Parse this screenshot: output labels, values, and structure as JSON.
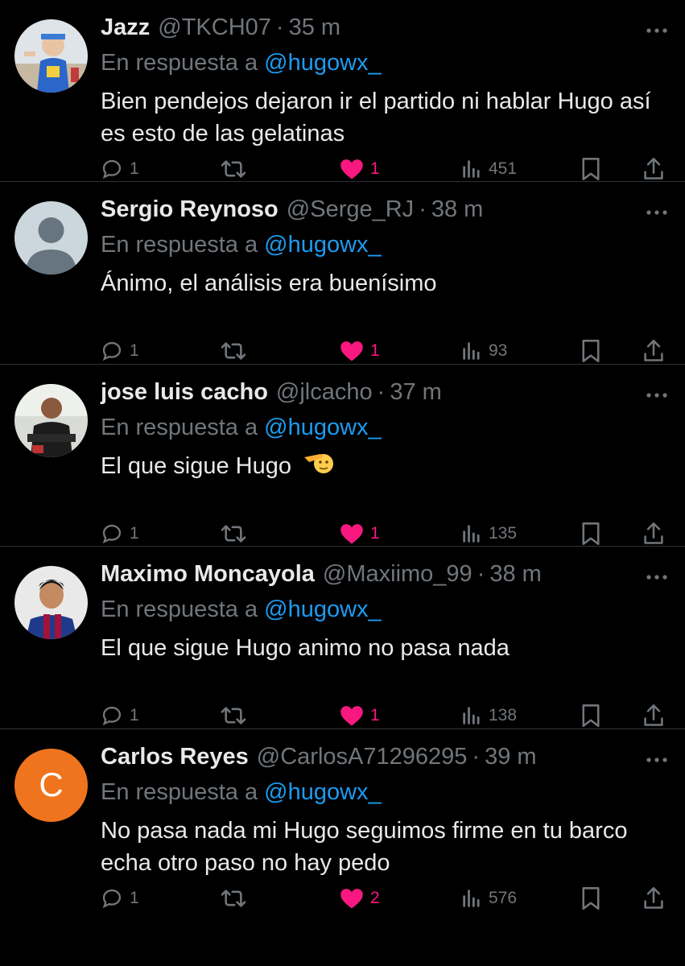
{
  "colors": {
    "background": "#000000",
    "text": "#e7e9ea",
    "muted": "#71767b",
    "mention": "#1d9bf0",
    "like": "#f91880",
    "divider": "#2f3336"
  },
  "replies": [
    {
      "name": "Jazz",
      "handle": "@TKCH07",
      "time": "35 m",
      "reply_prefix": "En respuesta a",
      "reply_to": "@hugowx_",
      "text": "Bien pendejos dejaron ir el partido ni hablar Hugo así es esto de las gelatinas",
      "avatar": "photo-child",
      "reply_count": "1",
      "retweet_count": "",
      "like_count": "1",
      "view_count": "451"
    },
    {
      "name": "Sergio Reynoso",
      "handle": "@Serge_RJ",
      "time": "38 m",
      "reply_prefix": "En respuesta a",
      "reply_to": "@hugowx_",
      "text": "Ánimo, el análisis era buenísimo",
      "avatar": "default-person",
      "reply_count": "1",
      "retweet_count": "",
      "like_count": "1",
      "view_count": "93"
    },
    {
      "name": "jose luis cacho",
      "handle": "@jlcacho",
      "time": "37 m",
      "reply_prefix": "En respuesta a",
      "reply_to": "@hugowx_",
      "text": "El que sigue Hugo",
      "text_emoji": "saluting-face",
      "avatar": "photo-man-gym",
      "reply_count": "1",
      "retweet_count": "",
      "like_count": "1",
      "view_count": "135"
    },
    {
      "name": "Maximo Moncayola",
      "handle": "@Maxiimo_99",
      "time": "38 m",
      "reply_prefix": "En respuesta a",
      "reply_to": "@hugowx_",
      "text": "El que sigue Hugo animo no pasa nada",
      "avatar": "photo-young-man",
      "reply_count": "1",
      "retweet_count": "",
      "like_count": "1",
      "view_count": "138"
    },
    {
      "name": "Carlos Reyes",
      "handle": "@CarlosA71296295",
      "time": "39 m",
      "reply_prefix": "En respuesta a",
      "reply_to": "@hugowx_",
      "text": "No pasa nada mi Hugo seguimos firme en tu barco echa otro paso no hay pedo",
      "avatar": "letter",
      "avatar_letter": "C",
      "avatar_color": "#f0741d",
      "reply_count": "1",
      "retweet_count": "",
      "like_count": "2",
      "view_count": "576"
    }
  ]
}
